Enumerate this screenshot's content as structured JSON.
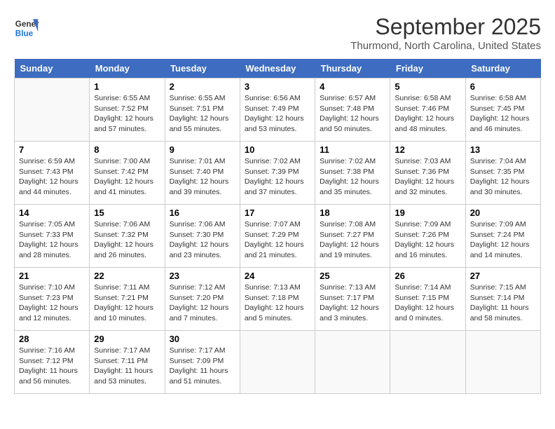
{
  "header": {
    "logo_line1": "General",
    "logo_line2": "Blue",
    "month": "September 2025",
    "location": "Thurmond, North Carolina, United States"
  },
  "weekdays": [
    "Sunday",
    "Monday",
    "Tuesday",
    "Wednesday",
    "Thursday",
    "Friday",
    "Saturday"
  ],
  "weeks": [
    [
      {
        "day": "",
        "info": ""
      },
      {
        "day": "1",
        "info": "Sunrise: 6:55 AM\nSunset: 7:52 PM\nDaylight: 12 hours\nand 57 minutes."
      },
      {
        "day": "2",
        "info": "Sunrise: 6:55 AM\nSunset: 7:51 PM\nDaylight: 12 hours\nand 55 minutes."
      },
      {
        "day": "3",
        "info": "Sunrise: 6:56 AM\nSunset: 7:49 PM\nDaylight: 12 hours\nand 53 minutes."
      },
      {
        "day": "4",
        "info": "Sunrise: 6:57 AM\nSunset: 7:48 PM\nDaylight: 12 hours\nand 50 minutes."
      },
      {
        "day": "5",
        "info": "Sunrise: 6:58 AM\nSunset: 7:46 PM\nDaylight: 12 hours\nand 48 minutes."
      },
      {
        "day": "6",
        "info": "Sunrise: 6:58 AM\nSunset: 7:45 PM\nDaylight: 12 hours\nand 46 minutes."
      }
    ],
    [
      {
        "day": "7",
        "info": "Sunrise: 6:59 AM\nSunset: 7:43 PM\nDaylight: 12 hours\nand 44 minutes."
      },
      {
        "day": "8",
        "info": "Sunrise: 7:00 AM\nSunset: 7:42 PM\nDaylight: 12 hours\nand 41 minutes."
      },
      {
        "day": "9",
        "info": "Sunrise: 7:01 AM\nSunset: 7:40 PM\nDaylight: 12 hours\nand 39 minutes."
      },
      {
        "day": "10",
        "info": "Sunrise: 7:02 AM\nSunset: 7:39 PM\nDaylight: 12 hours\nand 37 minutes."
      },
      {
        "day": "11",
        "info": "Sunrise: 7:02 AM\nSunset: 7:38 PM\nDaylight: 12 hours\nand 35 minutes."
      },
      {
        "day": "12",
        "info": "Sunrise: 7:03 AM\nSunset: 7:36 PM\nDaylight: 12 hours\nand 32 minutes."
      },
      {
        "day": "13",
        "info": "Sunrise: 7:04 AM\nSunset: 7:35 PM\nDaylight: 12 hours\nand 30 minutes."
      }
    ],
    [
      {
        "day": "14",
        "info": "Sunrise: 7:05 AM\nSunset: 7:33 PM\nDaylight: 12 hours\nand 28 minutes."
      },
      {
        "day": "15",
        "info": "Sunrise: 7:06 AM\nSunset: 7:32 PM\nDaylight: 12 hours\nand 26 minutes."
      },
      {
        "day": "16",
        "info": "Sunrise: 7:06 AM\nSunset: 7:30 PM\nDaylight: 12 hours\nand 23 minutes."
      },
      {
        "day": "17",
        "info": "Sunrise: 7:07 AM\nSunset: 7:29 PM\nDaylight: 12 hours\nand 21 minutes."
      },
      {
        "day": "18",
        "info": "Sunrise: 7:08 AM\nSunset: 7:27 PM\nDaylight: 12 hours\nand 19 minutes."
      },
      {
        "day": "19",
        "info": "Sunrise: 7:09 AM\nSunset: 7:26 PM\nDaylight: 12 hours\nand 16 minutes."
      },
      {
        "day": "20",
        "info": "Sunrise: 7:09 AM\nSunset: 7:24 PM\nDaylight: 12 hours\nand 14 minutes."
      }
    ],
    [
      {
        "day": "21",
        "info": "Sunrise: 7:10 AM\nSunset: 7:23 PM\nDaylight: 12 hours\nand 12 minutes."
      },
      {
        "day": "22",
        "info": "Sunrise: 7:11 AM\nSunset: 7:21 PM\nDaylight: 12 hours\nand 10 minutes."
      },
      {
        "day": "23",
        "info": "Sunrise: 7:12 AM\nSunset: 7:20 PM\nDaylight: 12 hours\nand 7 minutes."
      },
      {
        "day": "24",
        "info": "Sunrise: 7:13 AM\nSunset: 7:18 PM\nDaylight: 12 hours\nand 5 minutes."
      },
      {
        "day": "25",
        "info": "Sunrise: 7:13 AM\nSunset: 7:17 PM\nDaylight: 12 hours\nand 3 minutes."
      },
      {
        "day": "26",
        "info": "Sunrise: 7:14 AM\nSunset: 7:15 PM\nDaylight: 12 hours\nand 0 minutes."
      },
      {
        "day": "27",
        "info": "Sunrise: 7:15 AM\nSunset: 7:14 PM\nDaylight: 11 hours\nand 58 minutes."
      }
    ],
    [
      {
        "day": "28",
        "info": "Sunrise: 7:16 AM\nSunset: 7:12 PM\nDaylight: 11 hours\nand 56 minutes."
      },
      {
        "day": "29",
        "info": "Sunrise: 7:17 AM\nSunset: 7:11 PM\nDaylight: 11 hours\nand 53 minutes."
      },
      {
        "day": "30",
        "info": "Sunrise: 7:17 AM\nSunset: 7:09 PM\nDaylight: 11 hours\nand 51 minutes."
      },
      {
        "day": "",
        "info": ""
      },
      {
        "day": "",
        "info": ""
      },
      {
        "day": "",
        "info": ""
      },
      {
        "day": "",
        "info": ""
      }
    ]
  ]
}
